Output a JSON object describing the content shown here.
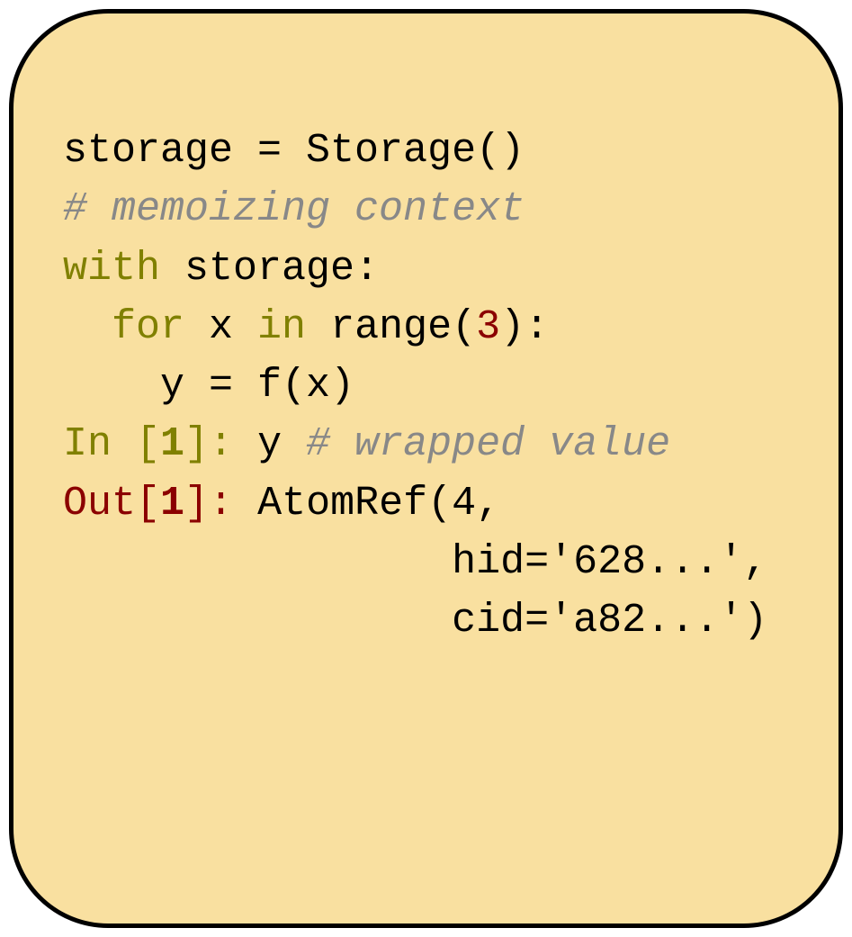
{
  "code": {
    "line1": "storage = Storage()",
    "blank1": "",
    "comment1": "# memoizing context",
    "line2a": "with",
    "line2b": " storage:",
    "line3a": "  ",
    "line3b": "for",
    "line3c": " x ",
    "line3d": "in",
    "line3e": " range(",
    "line3f": "3",
    "line3g": "):",
    "line4": "    y = f(x)",
    "blank2": "",
    "in_label": "In [",
    "in_num": "1",
    "in_close": "]:",
    "in_code": " y ",
    "in_comment": "# wrapped value",
    "out_label": "Out[",
    "out_num": "1",
    "out_close": "]:",
    "out_text1": " AtomRef(4,",
    "out_text2": "                hid='628...',",
    "out_text3": "                cid='a82...')"
  }
}
